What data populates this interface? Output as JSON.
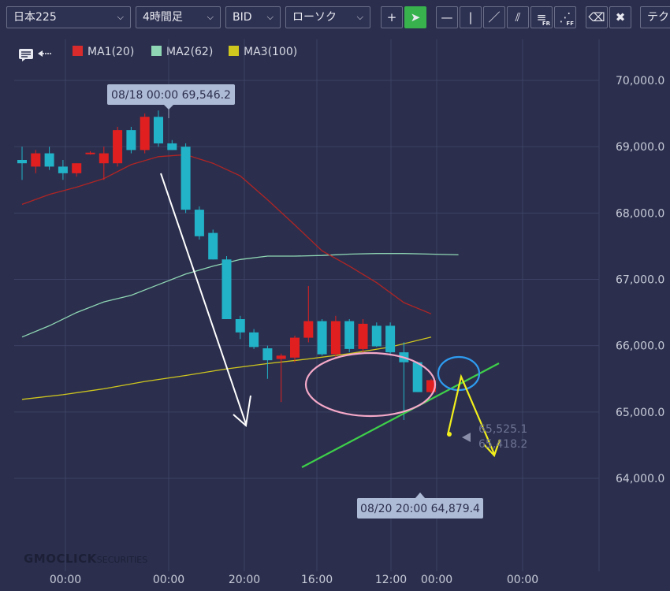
{
  "toolbar": {
    "symbol": "日本225",
    "timeframe": "4時間足",
    "price_type": "BID",
    "chart_style": "ローソク",
    "tools": [
      {
        "name": "crosshair-icon",
        "glyph": "+"
      },
      {
        "name": "pointer-icon",
        "glyph": "➤"
      },
      {
        "name": "horizontal-line-icon",
        "glyph": "—"
      },
      {
        "name": "vertical-line-icon",
        "glyph": "|"
      },
      {
        "name": "trendline-icon",
        "glyph": "／"
      },
      {
        "name": "parallel-lines-icon",
        "glyph": "⫽"
      },
      {
        "name": "fibonacci-retracement-icon",
        "glyph": "≡",
        "sub": "FR"
      },
      {
        "name": "fibonacci-fan-icon",
        "glyph": "⋰",
        "sub": "FF"
      },
      {
        "name": "eraser-icon",
        "glyph": "⌫"
      },
      {
        "name": "erase-all-icon",
        "glyph": "✖"
      }
    ],
    "tech_label": "テク"
  },
  "legend": {
    "ma1": {
      "label": "MA1(20)",
      "color": "#d92b2b"
    },
    "ma2": {
      "label": "MA2(62)",
      "color": "#8fd6b4"
    },
    "ma3": {
      "label": "MA3(100)",
      "color": "#cfc61e"
    }
  },
  "logo": {
    "main": "GMOCLICK",
    "sub": "SECURITIES"
  },
  "chart_data": {
    "type": "candlestick",
    "ylim": [
      63900,
      70500
    ],
    "y_ticks": [
      "70,000.0",
      "69,000.0",
      "68,000.0",
      "67,000.0",
      "66,000.0",
      "65,000.0",
      "64,000.0"
    ],
    "y_tick_values": [
      70000,
      69000,
      68000,
      67000,
      66000,
      65000,
      64000
    ],
    "x_tick_labels": [
      "00:00",
      "00:00",
      "20:00",
      "16:00",
      "12:00",
      "00:00",
      "00:00"
    ],
    "candles": [
      {
        "o": 68800,
        "h": 69000,
        "l": 68500,
        "c": 68750
      },
      {
        "o": 68700,
        "h": 68950,
        "l": 68600,
        "c": 68900
      },
      {
        "o": 68900,
        "h": 69000,
        "l": 68650,
        "c": 68700
      },
      {
        "o": 68700,
        "h": 68800,
        "l": 68500,
        "c": 68600
      },
      {
        "o": 68600,
        "h": 68750,
        "l": 68550,
        "c": 68750
      },
      {
        "o": 68900,
        "h": 68930,
        "l": 68880,
        "c": 68910
      },
      {
        "o": 68750,
        "h": 69000,
        "l": 68500,
        "c": 68900
      },
      {
        "o": 68750,
        "h": 69300,
        "l": 68700,
        "c": 69250
      },
      {
        "o": 69250,
        "h": 69300,
        "l": 68900,
        "c": 68950
      },
      {
        "o": 68950,
        "h": 69500,
        "l": 68900,
        "c": 69450
      },
      {
        "o": 69450,
        "h": 69546,
        "l": 69000,
        "c": 69050
      },
      {
        "o": 69050,
        "h": 69100,
        "l": 68950,
        "c": 68950
      },
      {
        "o": 69000,
        "h": 69050,
        "l": 68000,
        "c": 68050
      },
      {
        "o": 68050,
        "h": 68100,
        "l": 67600,
        "c": 67650
      },
      {
        "o": 67700,
        "h": 67750,
        "l": 67300,
        "c": 67300
      },
      {
        "o": 67300,
        "h": 67350,
        "l": 66400,
        "c": 66400
      },
      {
        "o": 66400,
        "h": 66450,
        "l": 66100,
        "c": 66200
      },
      {
        "o": 66200,
        "h": 66250,
        "l": 65950,
        "c": 65980
      },
      {
        "o": 65960,
        "h": 66000,
        "l": 65500,
        "c": 65780
      },
      {
        "o": 65800,
        "h": 65880,
        "l": 65150,
        "c": 65850
      },
      {
        "o": 65820,
        "h": 66150,
        "l": 65750,
        "c": 66120
      },
      {
        "o": 66120,
        "h": 66900,
        "l": 66050,
        "c": 66370
      },
      {
        "o": 66370,
        "h": 66400,
        "l": 65850,
        "c": 65870
      },
      {
        "o": 65870,
        "h": 66450,
        "l": 65800,
        "c": 66370
      },
      {
        "o": 66370,
        "h": 66400,
        "l": 65900,
        "c": 65950
      },
      {
        "o": 65950,
        "h": 66400,
        "l": 65900,
        "c": 66330
      },
      {
        "o": 66300,
        "h": 66350,
        "l": 65980,
        "c": 65990
      },
      {
        "o": 66300,
        "h": 66350,
        "l": 65850,
        "c": 65900
      },
      {
        "o": 65900,
        "h": 66050,
        "l": 64879,
        "c": 65750
      },
      {
        "o": 65750,
        "h": 65760,
        "l": 65300,
        "c": 65300
      },
      {
        "o": 65300,
        "h": 65500,
        "l": 65280,
        "c": 65480
      }
    ],
    "ma1": [
      [
        0,
        68130
      ],
      [
        2,
        68280
      ],
      [
        4,
        68390
      ],
      [
        6,
        68520
      ],
      [
        8,
        68730
      ],
      [
        10,
        68850
      ],
      [
        12,
        68880
      ],
      [
        14,
        68750
      ],
      [
        16,
        68560
      ],
      [
        18,
        68200
      ],
      [
        20,
        67820
      ],
      [
        22,
        67430
      ],
      [
        24,
        67200
      ],
      [
        26,
        66950
      ],
      [
        28,
        66650
      ],
      [
        30,
        66480
      ]
    ],
    "ma2": [
      [
        0,
        66130
      ],
      [
        2,
        66300
      ],
      [
        4,
        66500
      ],
      [
        6,
        66660
      ],
      [
        8,
        66760
      ],
      [
        10,
        66920
      ],
      [
        12,
        67080
      ],
      [
        14,
        67200
      ],
      [
        16,
        67300
      ],
      [
        18,
        67350
      ],
      [
        20,
        67350
      ],
      [
        22,
        67360
      ],
      [
        24,
        67380
      ],
      [
        26,
        67390
      ],
      [
        28,
        67390
      ],
      [
        30,
        67380
      ],
      [
        32,
        67370
      ]
    ],
    "ma3": [
      [
        0,
        65190
      ],
      [
        3,
        65260
      ],
      [
        6,
        65350
      ],
      [
        9,
        65460
      ],
      [
        12,
        65550
      ],
      [
        15,
        65650
      ],
      [
        18,
        65730
      ],
      [
        21,
        65800
      ],
      [
        24,
        65880
      ],
      [
        27,
        65980
      ],
      [
        30,
        66130
      ]
    ],
    "annotations": {
      "high_label": "08/18 00:00 69,546.2",
      "low_label": "08/20 20:00 64,879.4",
      "price_line_1": "65,525.1",
      "price_line_2": "65,418.2"
    }
  }
}
